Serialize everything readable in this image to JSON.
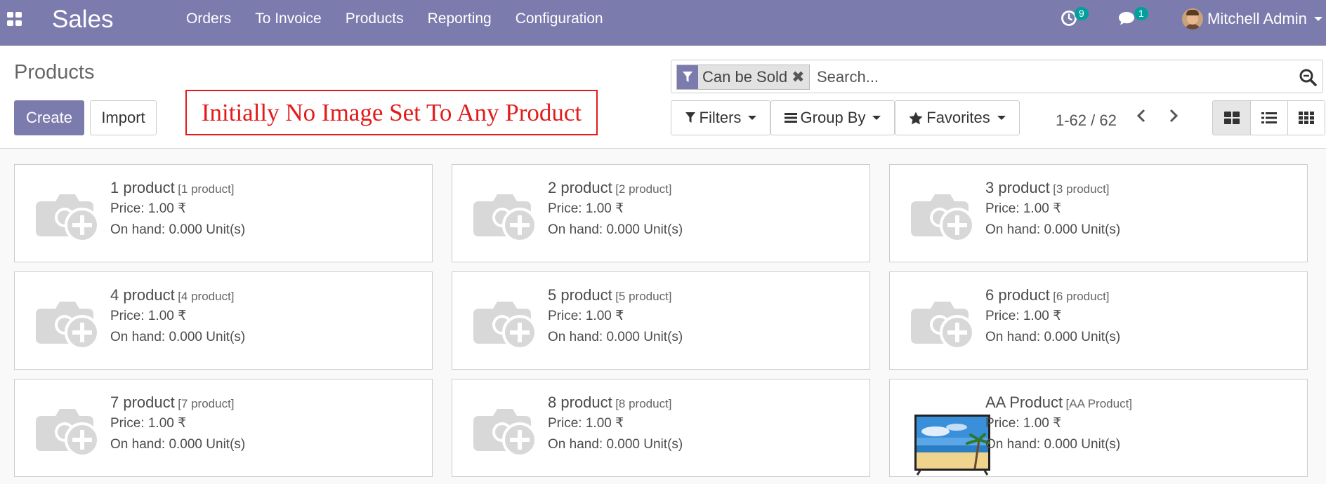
{
  "navbar": {
    "app_name": "Sales",
    "menu": [
      "Orders",
      "To Invoice",
      "Products",
      "Reporting",
      "Configuration"
    ],
    "activity_count": "9",
    "message_count": "1",
    "user_name": "Mitchell Admin"
  },
  "control_panel": {
    "title": "Products",
    "create_label": "Create",
    "import_label": "Import",
    "annotation": "Initially No Image Set To Any Product",
    "search": {
      "facet": "Can be Sold",
      "facet_remove": "✖",
      "placeholder": "Search..."
    },
    "filters_label": "Filters",
    "groupby_label": "Group By",
    "favorites_label": "Favorites",
    "pager": "1-62 / 62"
  },
  "products": [
    {
      "name": "1 product",
      "ref": "[1 product]",
      "price": "Price: 1.00 ₹",
      "onhand": "On hand: 0.000 Unit(s)"
    },
    {
      "name": "2 product",
      "ref": "[2 product]",
      "price": "Price: 1.00 ₹",
      "onhand": "On hand: 0.000 Unit(s)"
    },
    {
      "name": "3 product",
      "ref": "[3 product]",
      "price": "Price: 1.00 ₹",
      "onhand": "On hand: 0.000 Unit(s)"
    },
    {
      "name": "4 product",
      "ref": "[4 product]",
      "price": "Price: 1.00 ₹",
      "onhand": "On hand: 0.000 Unit(s)"
    },
    {
      "name": "5 product",
      "ref": "[5 product]",
      "price": "Price: 1.00 ₹",
      "onhand": "On hand: 0.000 Unit(s)"
    },
    {
      "name": "6 product",
      "ref": "[6 product]",
      "price": "Price: 1.00 ₹",
      "onhand": "On hand: 0.000 Unit(s)"
    },
    {
      "name": "7 product",
      "ref": "[7 product]",
      "price": "Price: 1.00 ₹",
      "onhand": "On hand: 0.000 Unit(s)"
    },
    {
      "name": "8 product",
      "ref": "[8 product]",
      "price": "Price: 1.00 ₹",
      "onhand": "On hand: 0.000 Unit(s)"
    },
    {
      "name": "AA Product",
      "ref": "[AA Product]",
      "price": "Price: 1.00 ₹",
      "onhand": "On hand: 0.000 Unit(s)"
    }
  ],
  "colors": {
    "brand": "#7c7bad",
    "badge": "#00a09d",
    "annotation": "#e31b1b"
  }
}
